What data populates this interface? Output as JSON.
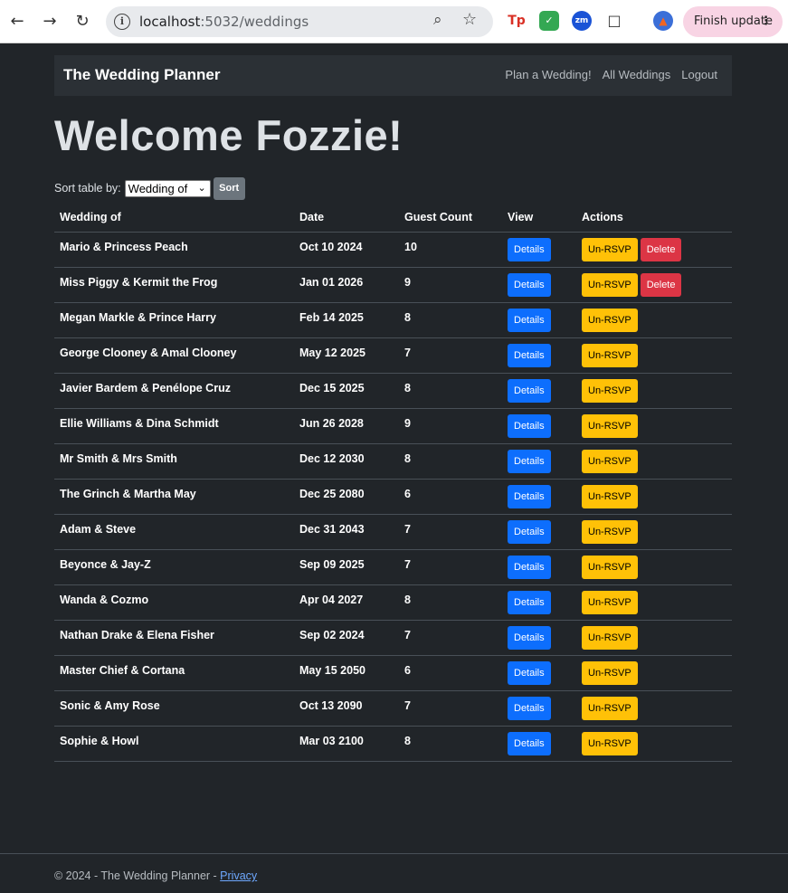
{
  "browser": {
    "url_host": "localhost",
    "url_path": ":5032/weddings",
    "finish_update": "Finish update"
  },
  "navbar": {
    "brand": "The Wedding Planner",
    "links": [
      "Plan a Wedding!",
      "All Weddings",
      "Logout"
    ]
  },
  "welcome": "Welcome Fozzie!",
  "sort": {
    "label": "Sort table by:",
    "selected": "Wedding of",
    "button": "Sort"
  },
  "table": {
    "headers": [
      "Wedding of",
      "Date",
      "Guest Count",
      "View",
      "Actions"
    ],
    "rows": [
      {
        "name": "Mario & Princess Peach",
        "date": "Oct 10 2024",
        "guests": "10",
        "delete": true
      },
      {
        "name": "Miss Piggy & Kermit the Frog",
        "date": "Jan 01 2026",
        "guests": "9",
        "delete": true
      },
      {
        "name": "Megan Markle & Prince Harry",
        "date": "Feb 14 2025",
        "guests": "8",
        "delete": false
      },
      {
        "name": "George Clooney & Amal Clooney",
        "date": "May 12 2025",
        "guests": "7",
        "delete": false
      },
      {
        "name": "Javier Bardem & Penélope Cruz",
        "date": "Dec 15 2025",
        "guests": "8",
        "delete": false
      },
      {
        "name": "Ellie Williams & Dina Schmidt",
        "date": "Jun 26 2028",
        "guests": "9",
        "delete": false
      },
      {
        "name": "Mr Smith & Mrs Smith",
        "date": "Dec 12 2030",
        "guests": "8",
        "delete": false
      },
      {
        "name": "The Grinch & Martha May",
        "date": "Dec 25 2080",
        "guests": "6",
        "delete": false
      },
      {
        "name": "Adam & Steve",
        "date": "Dec 31 2043",
        "guests": "7",
        "delete": false
      },
      {
        "name": "Beyonce & Jay-Z",
        "date": "Sep 09 2025",
        "guests": "7",
        "delete": false
      },
      {
        "name": "Wanda & Cozmo",
        "date": "Apr 04 2027",
        "guests": "8",
        "delete": false
      },
      {
        "name": "Nathan Drake & Elena Fisher",
        "date": "Sep 02 2024",
        "guests": "7",
        "delete": false
      },
      {
        "name": "Master Chief & Cortana",
        "date": "May 15 2050",
        "guests": "6",
        "delete": false
      },
      {
        "name": "Sonic & Amy Rose",
        "date": "Oct 13 2090",
        "guests": "7",
        "delete": false
      },
      {
        "name": "Sophie & Howl",
        "date": "Mar 03 2100",
        "guests": "8",
        "delete": false
      }
    ],
    "labels": {
      "details": "Details",
      "unrsvp": "Un-RSVP",
      "delete": "Delete"
    }
  },
  "footer": {
    "text": "© 2024 - The Wedding Planner - ",
    "link": "Privacy"
  }
}
